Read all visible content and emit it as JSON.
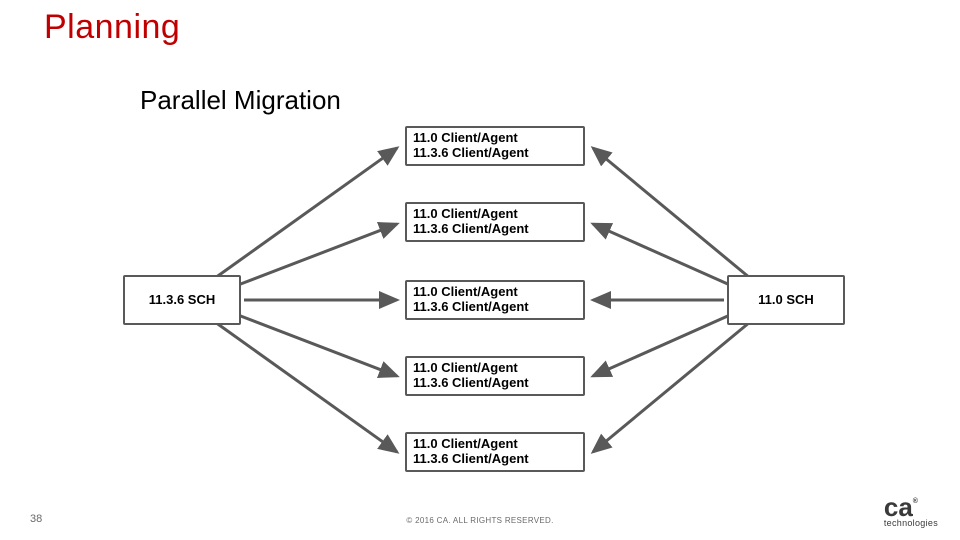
{
  "title": "Planning",
  "section": "Parallel Migration",
  "slide_number": "38",
  "copyright": "© 2016 CA. ALL RIGHTS RESERVED.",
  "logo": {
    "main": "ca",
    "trademark": "®",
    "sub": "technologies"
  },
  "diagram": {
    "left_node": "11.3.6 SCH",
    "right_node": "11.0 SCH",
    "agents": [
      {
        "line1": "11.0 Client/Agent",
        "line2": "11.3.6 Client/Agent"
      },
      {
        "line1": "11.0 Client/Agent",
        "line2": "11.3.6 Client/Agent"
      },
      {
        "line1": "11.0 Client/Agent",
        "line2": "11.3.6 Client/Agent"
      },
      {
        "line1": "11.0 Client/Agent",
        "line2": "11.3.6 Client/Agent"
      },
      {
        "line1": "11.0 Client/Agent",
        "line2": "11.3.6 Client/Agent"
      }
    ]
  }
}
